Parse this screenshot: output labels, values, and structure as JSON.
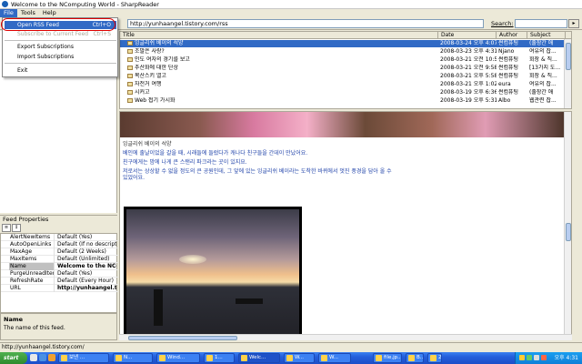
{
  "window": {
    "title": "Welcome to the NComputing World - SharpReader"
  },
  "menu": {
    "items": [
      "File",
      "Tools",
      "Help"
    ]
  },
  "file_menu": {
    "items": [
      {
        "label": "Open RSS Feed",
        "shortcut": "Ctrl+O"
      },
      {
        "label": "Subscribe to Current Feed",
        "shortcut": "Ctrl+S"
      },
      {
        "label": "Export Subscriptions",
        "shortcut": ""
      },
      {
        "label": "Import Subscriptions",
        "shortcut": ""
      },
      {
        "label": "Exit",
        "shortcut": ""
      }
    ]
  },
  "toolbar": {
    "address_value": "http://yunhaangel.tistory.com/rss",
    "search_label": "Search:"
  },
  "item_list": {
    "columns": [
      "Title",
      "Date",
      "Author",
      "Subject"
    ],
    "rows": [
      {
        "title": "잉글리쉬 베이의 석양",
        "date": "2008-03-24 오후 4:07",
        "author": "썬컴퓨팅",
        "subject": "(출장간 애"
      },
      {
        "title": "조말은 사랑?",
        "date": "2008-03-23 오후 4:31",
        "author": "Njano",
        "subject": "여유의 잡..."
      },
      {
        "title": "인도 여자의 경기를 보고",
        "date": "2008-03-21 오전 10:57",
        "author": "썬컴퓨팅",
        "subject": "회장 & 직..."
      },
      {
        "title": "추산화에 대한 단상",
        "date": "2008-03-21 오전 9:58",
        "author": "썬컴퓨팅",
        "subject": "[13가지 도..."
      },
      {
        "title": "목산스키 열고",
        "date": "2008-03-21 오후 5:58",
        "author": "썬컴퓨팅",
        "subject": "회장 & 직..."
      },
      {
        "title": "자전거 여행",
        "date": "2008-03-21 오후 1:02",
        "author": "eura",
        "subject": "여유의 잡..."
      },
      {
        "title": "시커고",
        "date": "2008-03-19 오후 6:36",
        "author": "썬컴퓨팅",
        "subject": "(출장간 애"
      },
      {
        "title": "Web 접기 가시화",
        "date": "2008-03-19 오후 5:31",
        "author": "Albo",
        "subject": "웹관련 잡..."
      }
    ]
  },
  "article": {
    "title": "잉글리쉬 베이의 석양",
    "paragraphs": [
      "베인에 출날이었을 갈을 때, 시래들에 들렀다가 캐나다 친구들을 간데이 만났어요.",
      "친구에게는 밤에 나게 큰 스탠리 파크라는 곳이 있지요.",
      "저로서는 상상할 수 없을 정도의 큰 공원인데, 그 앞에 있는 잉글리쉬 베이라는 도착한 바퀴에서 멋진 풍경을 담아 올 수 있었어요."
    ]
  },
  "properties": {
    "title": "Feed Properties",
    "rows": [
      {
        "name": "AlertNewItems",
        "value": "Default (Yes)"
      },
      {
        "name": "AutoOpenLinks",
        "value": "Default (If no description)"
      },
      {
        "name": "MaxAge",
        "value": "Default (2 Weeks)"
      },
      {
        "name": "MaxItems",
        "value": "Default (Unlimited)"
      },
      {
        "name": "Name",
        "value": "Welcome to the NComputing World"
      },
      {
        "name": "PurgeUnreadItems",
        "value": "Default (Yes)"
      },
      {
        "name": "RefreshRate",
        "value": "Default (Every Hour)"
      },
      {
        "name": "URL",
        "value": "http://yunhaangel.tistory.com/rss"
      }
    ],
    "description_name": "Name",
    "description_text": "The name of this feed."
  },
  "status": {
    "text": "http://yunhaangel.tistory.com/"
  },
  "taskbar": {
    "start_label": "start",
    "tasks": [
      "보낸 ...",
      "N...",
      "Wind...",
      "1...",
      "Welc...",
      "W...",
      "W...",
      "file,jp...",
      "B...",
      "2..."
    ],
    "clock": "오후 4:31"
  },
  "colors": {
    "selection": "#316ac5",
    "title_ring": "#dd0000",
    "taskbar": "#245edb"
  }
}
